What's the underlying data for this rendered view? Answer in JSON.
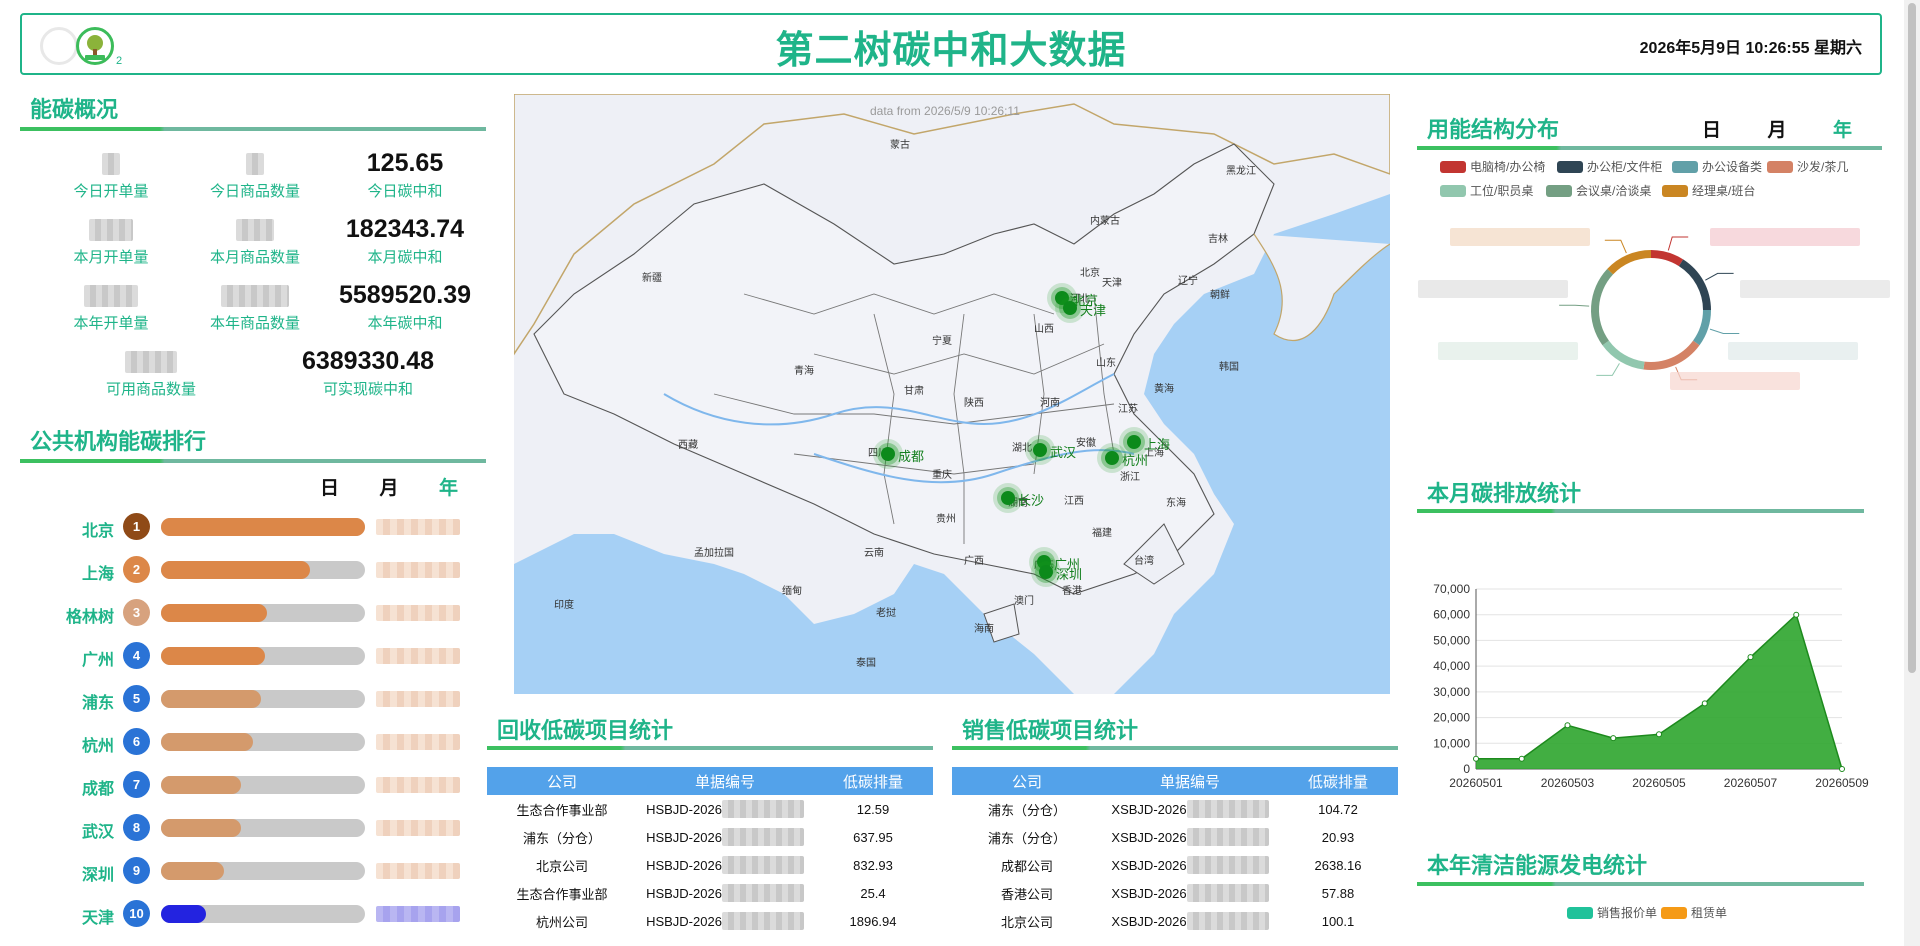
{
  "header": {
    "title": "第二树碳中和大数据",
    "clock": "2026年5月9日 10:26:55 星期六",
    "logo_sub": "2"
  },
  "overview": {
    "title": "能碳概况",
    "items": [
      {
        "label": "今日开单量",
        "value": ""
      },
      {
        "label": "今日商品数量",
        "value": ""
      },
      {
        "label": "今日碳中和",
        "value": "125.65"
      },
      {
        "label": "本月开单量",
        "value": ""
      },
      {
        "label": "本月商品数量",
        "value": ""
      },
      {
        "label": "本月碳中和",
        "value": "182343.74"
      },
      {
        "label": "本年开单量",
        "value": ""
      },
      {
        "label": "本年商品数量",
        "value": ""
      },
      {
        "label": "本年碳中和",
        "value": "5589520.39"
      },
      {
        "label": "可用商品数量",
        "value": ""
      },
      {
        "label": "可实现碳中和",
        "value": "6389330.48"
      }
    ]
  },
  "ranking": {
    "title": "公共机构能碳排行",
    "tabs": [
      "日",
      "月",
      "年"
    ],
    "active_tab": "年",
    "rows": [
      {
        "rank": "1",
        "city": "北京",
        "fill": 1.0,
        "badge": "#8f4a17",
        "bar": "#dc8748"
      },
      {
        "rank": "2",
        "city": "上海",
        "fill": 0.73,
        "badge": "#dc8748",
        "bar": "#dc8748"
      },
      {
        "rank": "3",
        "city": "格林树",
        "fill": 0.52,
        "badge": "#d7a27e",
        "bar": "#dc8748"
      },
      {
        "rank": "4",
        "city": "广州",
        "fill": 0.51,
        "badge": "#2a73d6",
        "bar": "#dc8748"
      },
      {
        "rank": "5",
        "city": "浦东",
        "fill": 0.49,
        "badge": "#2a73d6",
        "bar": "#d49a6c"
      },
      {
        "rank": "6",
        "city": "杭州",
        "fill": 0.45,
        "badge": "#2a73d6",
        "bar": "#d49a6c"
      },
      {
        "rank": "7",
        "city": "成都",
        "fill": 0.39,
        "badge": "#2a73d6",
        "bar": "#d49a6c"
      },
      {
        "rank": "8",
        "city": "武汉",
        "fill": 0.39,
        "badge": "#2a73d6",
        "bar": "#d49a6c"
      },
      {
        "rank": "9",
        "city": "深圳",
        "fill": 0.31,
        "badge": "#2a73d6",
        "bar": "#d49a6c"
      },
      {
        "rank": "10",
        "city": "天津",
        "fill": 0.22,
        "badge": "#2a73d6",
        "bar": "#2323e0"
      }
    ]
  },
  "map": {
    "note": "data from 2026/5/9 10:26:11",
    "region_labels": [
      "蒙古",
      "新疆",
      "内蒙古",
      "黑龙江",
      "吉林",
      "辽宁",
      "朝鲜",
      "韩国",
      "北京",
      "天津",
      "河北",
      "山西",
      "山东",
      "宁夏",
      "甘肃",
      "青海",
      "陕西",
      "河南",
      "江苏",
      "西藏",
      "四川",
      "重庆",
      "湖北",
      "安徽",
      "上海",
      "浙江",
      "湖南",
      "江西",
      "贵州",
      "福建",
      "云南",
      "广西",
      "广东",
      "台湾",
      "香港",
      "澳门",
      "海南",
      "东海",
      "黄海",
      "孟加拉国",
      "印度",
      "缅甸",
      "老挝",
      "泰国"
    ],
    "cities": [
      "北京",
      "天津",
      "成都",
      "武汉",
      "上海",
      "杭州",
      "长沙",
      "广州",
      "深圳"
    ]
  },
  "recycle": {
    "title": "回收低碳项目统计",
    "headers": [
      "公司",
      "单据编号",
      "低碳排量"
    ],
    "rows": [
      [
        "生态合作事业部",
        "HSBJD-2026",
        "12.59"
      ],
      [
        "浦东（分仓）",
        "HSBJD-2026",
        "637.95"
      ],
      [
        "北京公司",
        "HSBJD-2026",
        "832.93"
      ],
      [
        "生态合作事业部",
        "HSBJD-2026",
        "25.4"
      ],
      [
        "杭州公司",
        "HSBJD-2026",
        "1896.94"
      ]
    ]
  },
  "sales": {
    "title": "销售低碳项目统计",
    "headers": [
      "公司",
      "单据编号",
      "低碳排量"
    ],
    "rows": [
      [
        "浦东（分仓）",
        "XSBJD-2026",
        "104.72"
      ],
      [
        "浦东（分仓）",
        "XSBJD-2026",
        "20.93"
      ],
      [
        "成都公司",
        "XSBJD-2026",
        "2638.16"
      ],
      [
        "香港公司",
        "XSBJD-2026",
        "57.88"
      ],
      [
        "北京公司",
        "XSBJD-2026",
        "100.1"
      ]
    ]
  },
  "energy_structure": {
    "title": "用能结构分布",
    "tabs": [
      "日",
      "月",
      "年"
    ],
    "active_tab": "年",
    "legend": [
      {
        "name": "电脑椅/办公椅",
        "color": "#c23531"
      },
      {
        "name": "办公柜/文件柜",
        "color": "#2f4554"
      },
      {
        "name": "办公设备类",
        "color": "#61a0a8"
      },
      {
        "name": "沙发/茶几",
        "color": "#d48265"
      },
      {
        "name": "工位/职员桌",
        "color": "#91c7ae"
      },
      {
        "name": "会议桌/洽谈桌",
        "color": "#749f83"
      },
      {
        "name": "经理桌/班台",
        "color": "#ca8622"
      }
    ],
    "slices": [
      {
        "name": "电脑椅/办公椅",
        "value": 9,
        "color": "#c23531"
      },
      {
        "name": "办公柜/文件柜",
        "value": 16,
        "color": "#2f4554"
      },
      {
        "name": "办公设备类",
        "value": 10,
        "color": "#61a0a8"
      },
      {
        "name": "沙发/茶几",
        "value": 17,
        "color": "#d48265"
      },
      {
        "name": "工位/职员桌",
        "value": 13,
        "color": "#91c7ae"
      },
      {
        "name": "会议桌/洽谈桌",
        "value": 22,
        "color": "#749f83"
      },
      {
        "name": "经理桌/班台",
        "value": 13,
        "color": "#ca8622"
      }
    ]
  },
  "monthly_emission": {
    "title": "本月碳排放统计"
  },
  "chart_data": {
    "type": "area",
    "x": [
      "20260501",
      "20260502",
      "20260503",
      "20260504",
      "20260505",
      "20260506",
      "20260507",
      "20260508",
      "20260509"
    ],
    "x_tick_labels": [
      "20260501",
      "20260503",
      "20260505",
      "20260507",
      "20260509"
    ],
    "series": [
      {
        "values": [
          4000,
          4000,
          17000,
          12000,
          13500,
          25500,
          43500,
          60000,
          0
        ]
      }
    ],
    "ylim": [
      0,
      70000
    ],
    "y_ticks": [
      "0",
      "10,000",
      "20,000",
      "30,000",
      "40,000",
      "50,000",
      "60,000",
      "70,000"
    ],
    "grid": true,
    "color": "#2ea52e"
  },
  "clean_energy": {
    "title": "本年清洁能源发电统计",
    "legend": [
      {
        "name": "销售报价单",
        "color": "#20c29a"
      },
      {
        "name": "租赁单",
        "color": "#f59a16"
      }
    ]
  }
}
